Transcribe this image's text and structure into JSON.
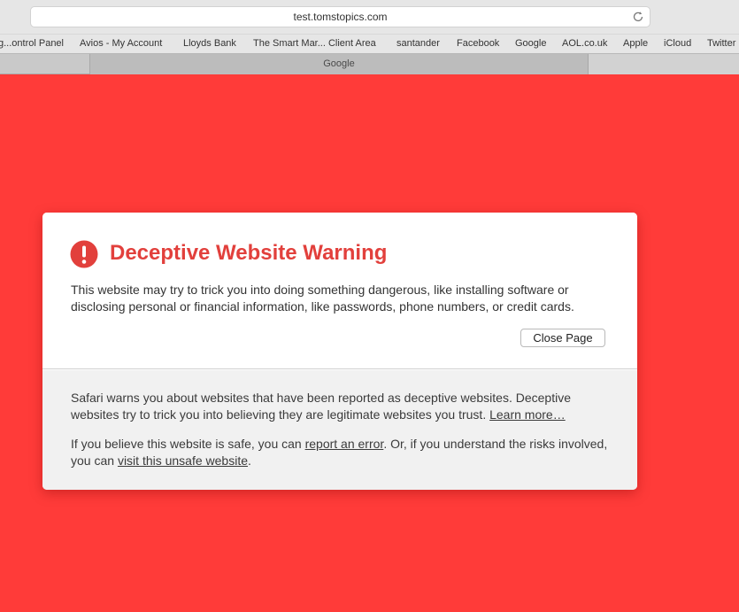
{
  "browser": {
    "address": "test.tomstopics.com",
    "bookmarks": [
      "g...ontrol Panel",
      "Avios - My Account",
      "Lloyds Bank",
      "The Smart Mar... Client Area",
      "santander",
      "Facebook",
      "Google",
      "AOL.co.uk",
      "Apple",
      "iCloud",
      "Twitter"
    ],
    "active_tab": "Google"
  },
  "warning": {
    "title": "Deceptive Website Warning",
    "description": "This website may try to trick you into doing something dangerous, like installing software or disclosing personal or financial information, like passwords, phone numbers, or credit cards.",
    "close_button": "Close Page",
    "info_text": "Safari warns you about websites that have been reported as deceptive websites. Deceptive websites try to trick you into believing they are legitimate websites you trust.",
    "learn_more": "Learn more…",
    "safe_prefix": "If you believe this website is safe, you can",
    "report_link": "report an error",
    "safe_middle": ". Or, if you understand the risks involved, you can",
    "visit_link": "visit this unsafe website",
    "safe_suffix": "."
  },
  "colors": {
    "page_background": "#ff3b39",
    "title_red": "#e2403c"
  },
  "icons": {
    "warning": "exclamation-circle-icon",
    "reload": "reload-icon"
  }
}
